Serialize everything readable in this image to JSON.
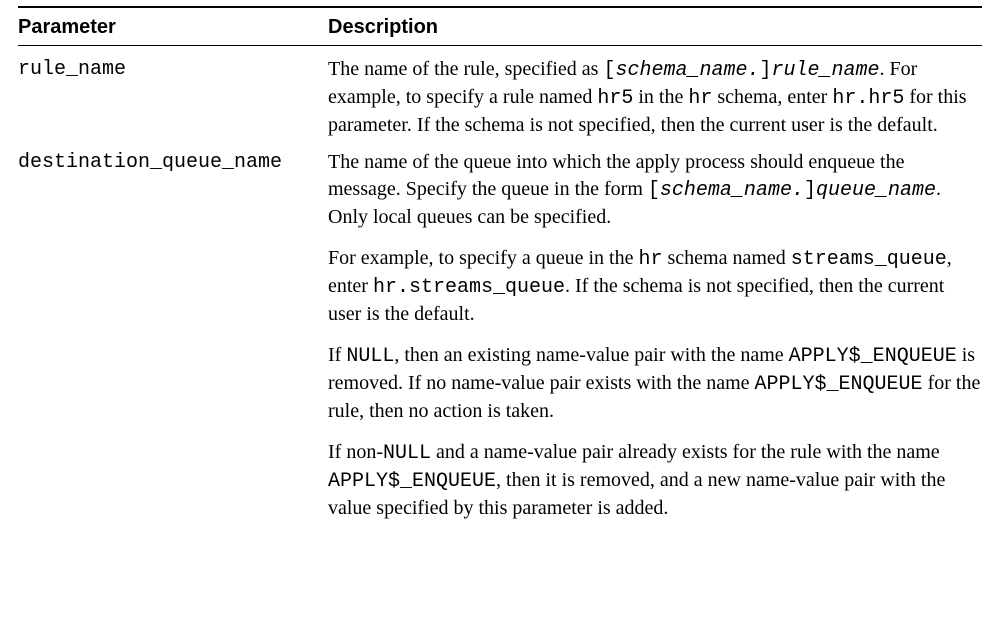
{
  "table": {
    "headers": {
      "parameter": "Parameter",
      "description": "Description"
    },
    "rows": [
      {
        "param": "rule_name",
        "description": [
          [
            {
              "t": "The name of the rule, specified as "
            },
            {
              "t": "[",
              "cls": "mono"
            },
            {
              "t": "schema_name.",
              "cls": "mono-italic"
            },
            {
              "t": "]",
              "cls": "mono"
            },
            {
              "t": "rule_name",
              "cls": "mono-italic"
            },
            {
              "t": ". For example, to specify a rule named "
            },
            {
              "t": "hr5",
              "cls": "mono"
            },
            {
              "t": " in the "
            },
            {
              "t": "hr",
              "cls": "mono"
            },
            {
              "t": " schema, enter "
            },
            {
              "t": "hr.hr5",
              "cls": "mono"
            },
            {
              "t": " for this parameter. If the schema is not specified, then the current user is the default."
            }
          ]
        ]
      },
      {
        "param": "destination_queue_name",
        "description": [
          [
            {
              "t": "The name of the queue into which the apply process should enqueue the message. Specify the queue in the form "
            },
            {
              "t": "[",
              "cls": "mono"
            },
            {
              "t": "schema_name.",
              "cls": "mono-italic"
            },
            {
              "t": "]",
              "cls": "mono"
            },
            {
              "t": "queue_name",
              "cls": "mono-italic"
            },
            {
              "t": ". Only local queues can be specified."
            }
          ],
          [
            {
              "t": "For example, to specify a queue in the "
            },
            {
              "t": "hr",
              "cls": "mono"
            },
            {
              "t": " schema named "
            },
            {
              "t": "streams_queue",
              "cls": "mono"
            },
            {
              "t": ", enter "
            },
            {
              "t": "hr.streams_queue",
              "cls": "mono"
            },
            {
              "t": ". If the schema is not specified, then the current user is the default."
            }
          ],
          [
            {
              "t": "If "
            },
            {
              "t": "NULL",
              "cls": "mono"
            },
            {
              "t": ", then an existing name-value pair with the name "
            },
            {
              "t": "APPLY$_ENQUEUE",
              "cls": "mono"
            },
            {
              "t": " is removed. If no name-value pair exists with the name "
            },
            {
              "t": "APPLY$_ENQUEUE",
              "cls": "mono"
            },
            {
              "t": " for the rule, then no action is taken."
            }
          ],
          [
            {
              "t": "If non-"
            },
            {
              "t": "NULL",
              "cls": "mono"
            },
            {
              "t": " and a name-value pair already exists for the rule with the name "
            },
            {
              "t": "APPLY$_ENQUEUE",
              "cls": "mono"
            },
            {
              "t": ", then it is removed, and a new name-value pair with the value specified by this parameter is added."
            }
          ]
        ]
      }
    ]
  }
}
